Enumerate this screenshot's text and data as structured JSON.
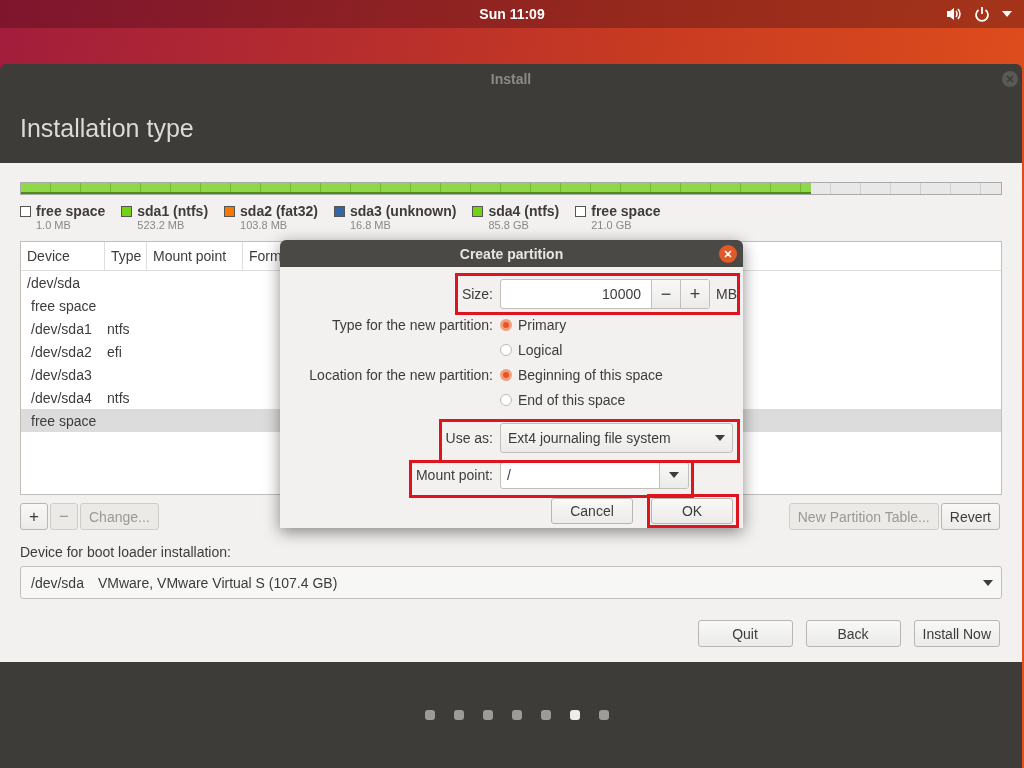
{
  "top_bar": {
    "clock": "Sun 11:09"
  },
  "window": {
    "title": "Install",
    "heading": "Installation type"
  },
  "partition_bar": {
    "level": 0.806
  },
  "legend": [
    {
      "name": "free space",
      "size": "1.0 MB",
      "color": "#ffffff"
    },
    {
      "name": "sda1 (ntfs)",
      "size": "523.2 MB",
      "color": "#73d216"
    },
    {
      "name": "sda2 (fat32)",
      "size": "103.8 MB",
      "color": "#f57900"
    },
    {
      "name": "sda3 (unknown)",
      "size": "16.8 MB",
      "color": "#3465a4"
    },
    {
      "name": "sda4 (ntfs)",
      "size": "85.8 GB",
      "color": "#73d216"
    },
    {
      "name": "free space",
      "size": "21.0 GB",
      "color": "#ffffff"
    }
  ],
  "table": {
    "columns": [
      "Device",
      "Type",
      "Mount point",
      "Form"
    ],
    "rows": [
      {
        "device": "/dev/sda",
        "selected": false,
        "children": [
          {
            "device": "free space",
            "selected": false
          },
          {
            "device": "/dev/sda1",
            "type": "ntfs",
            "selected": false
          },
          {
            "device": "/dev/sda2",
            "type": "efi",
            "selected": false
          },
          {
            "device": "/dev/sda3",
            "selected": false
          },
          {
            "device": "/dev/sda4",
            "type": "ntfs",
            "selected": false
          },
          {
            "device": "free space",
            "selected": true
          }
        ]
      }
    ]
  },
  "table_buttons": [
    {
      "label": "+",
      "disabled": false
    },
    {
      "label": "−",
      "disabled": true
    },
    {
      "label": "Change...",
      "disabled": true
    }
  ],
  "right_buttons": [
    {
      "label": "New Partition Table...",
      "disabled": true
    },
    {
      "label": "Revert",
      "disabled": false
    }
  ],
  "boot_loader": {
    "label": "Device for boot loader installation:",
    "device": "/dev/sda",
    "description": "VMware, VMware Virtual S (107.4 GB)"
  },
  "nav_buttons": [
    "Quit",
    "Back",
    "Install Now"
  ],
  "progress_dots": [
    {
      "selected": false
    },
    {
      "selected": false
    },
    {
      "selected": false
    },
    {
      "selected": false
    },
    {
      "selected": false
    },
    {
      "selected": true
    },
    {
      "selected": false
    }
  ],
  "dialog": {
    "title": "Create partition",
    "size": {
      "label": "Size:",
      "value": "10000",
      "stepper": [
        "−",
        "+"
      ],
      "unit": "MB",
      "highlighted": true
    },
    "type": {
      "label": "Type for the new partition:",
      "options": [
        {
          "label": "Primary",
          "selected": true
        },
        {
          "label": "Logical",
          "selected": false
        }
      ]
    },
    "location": {
      "label": "Location for the new partition:",
      "options": [
        {
          "label": "Beginning of this space",
          "selected": true
        },
        {
          "label": "End of this space",
          "selected": false
        }
      ]
    },
    "use_as": {
      "label": "Use as:",
      "value": "Ext4 journaling file system",
      "highlighted": true
    },
    "mount_point": {
      "label": "Mount point:",
      "value": "/",
      "highlighted": true
    },
    "buttons": [
      {
        "label": "Cancel",
        "highlighted": false
      },
      {
        "label": "OK",
        "highlighted": true
      }
    ]
  }
}
